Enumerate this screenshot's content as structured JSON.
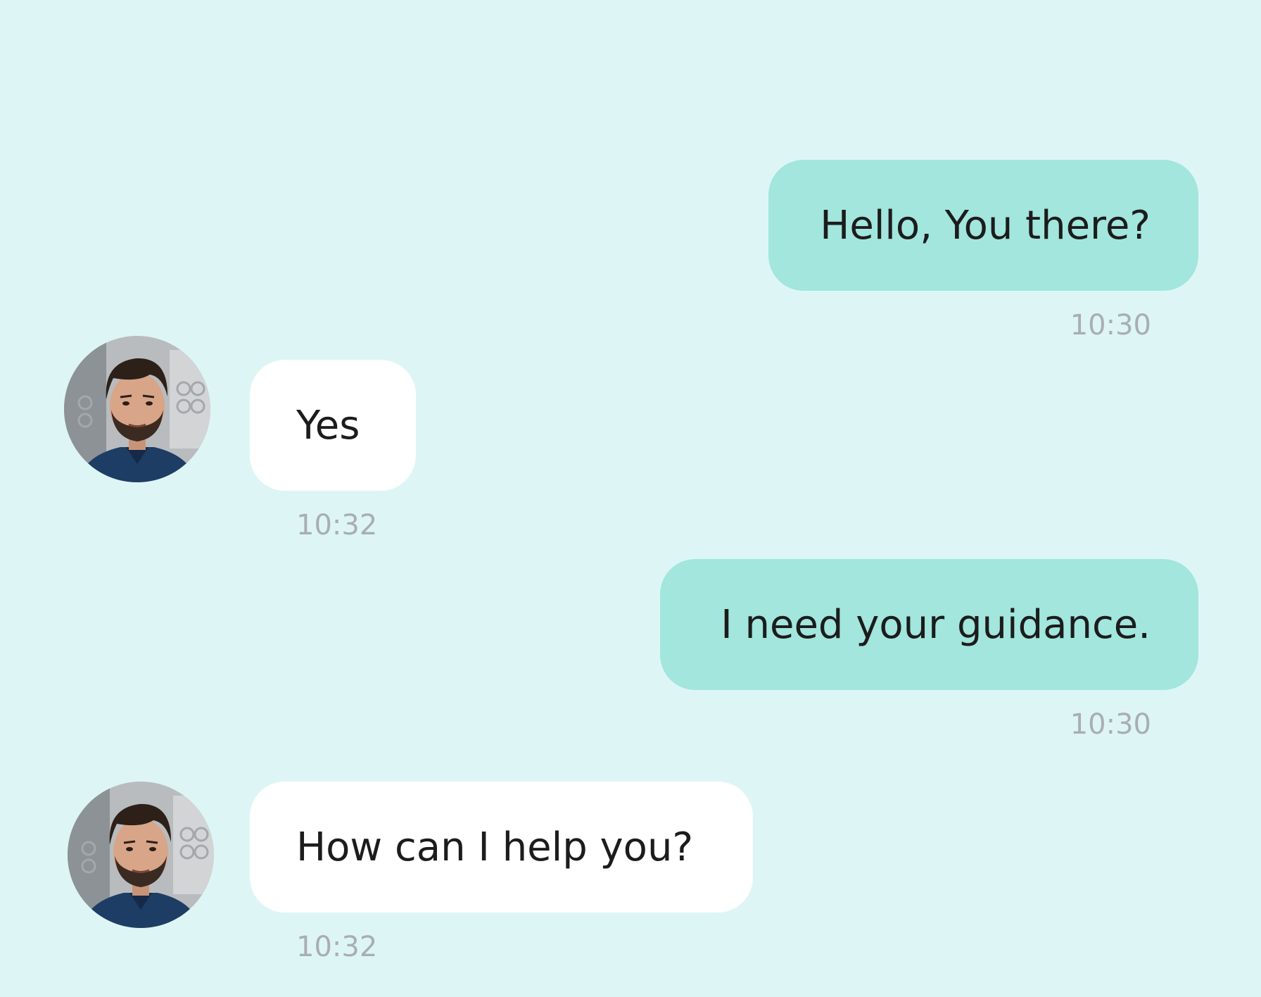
{
  "messages": [
    {
      "direction": "outgoing",
      "text": "Hello, You there?",
      "time": "10:30"
    },
    {
      "direction": "incoming",
      "text": "Yes",
      "time": "10:32",
      "avatar": "user-portrait-avatar"
    },
    {
      "direction": "outgoing",
      "text": "I need your guidance.",
      "time": "10:30"
    },
    {
      "direction": "incoming",
      "text": "How can I help you?",
      "time": "10:32",
      "avatar": "user-portrait-avatar"
    }
  ],
  "colors": {
    "background": "#ddf6f5",
    "outgoing_bubble": "#a2e6dd",
    "incoming_bubble": "#ffffff",
    "message_text": "#1c1c1c",
    "timestamp": "#a9aeb3"
  }
}
